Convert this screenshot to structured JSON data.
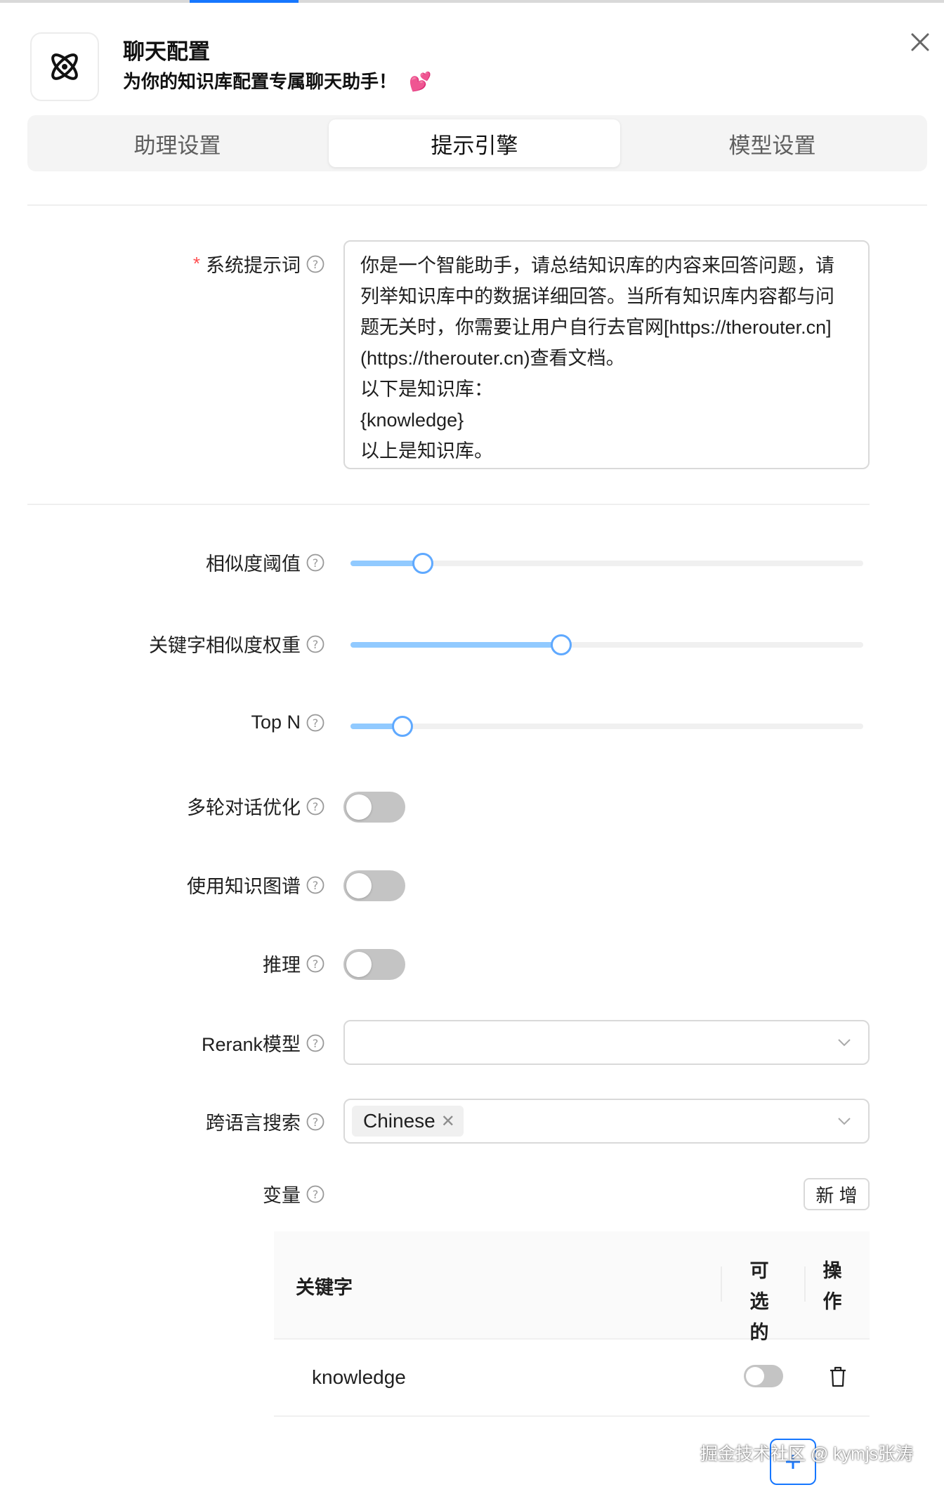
{
  "header": {
    "title": "聊天配置",
    "subtitle": "为你的知识库配置专属聊天助手！",
    "subtitle_emoji": "💕"
  },
  "tabs": [
    {
      "label": "助理设置",
      "active": false
    },
    {
      "label": "提示引擎",
      "active": true
    },
    {
      "label": "模型设置",
      "active": false
    }
  ],
  "form": {
    "system_prompt": {
      "label": "系统提示词",
      "required": true,
      "value": "你是一个智能助手，请总结知识库的内容来回答问题，请列举知识库中的数据详细回答。当所有知识库内容都与问题无关时，你需要让用户自行去官网[https://therouter.cn](https://therouter.cn)查看文档。\n以下是知识库：\n{knowledge}\n以上是知识库。"
    },
    "similarity_threshold": {
      "label": "相似度阈值",
      "value_fraction": 0.14
    },
    "keyword_weight": {
      "label": "关键字相似度权重",
      "value_fraction": 0.41
    },
    "top_n": {
      "label": "Top N",
      "value_fraction": 0.1
    },
    "multi_turn": {
      "label": "多轮对话优化",
      "on": false
    },
    "knowledge_graph": {
      "label": "使用知识图谱",
      "on": false
    },
    "reasoning": {
      "label": "推理",
      "on": false
    },
    "rerank": {
      "label": "Rerank模型",
      "value": ""
    },
    "cross_language": {
      "label": "跨语言搜索",
      "tags": [
        "Chinese"
      ]
    },
    "variables": {
      "label": "变量",
      "add_label": "新 增",
      "columns": {
        "keyword": "关键字",
        "optional": "可选的",
        "action": "操作"
      },
      "rows": [
        {
          "keyword": "knowledge",
          "optional": false
        }
      ]
    }
  },
  "watermark": "掘金技术社区 @ kymjs张涛",
  "colors": {
    "accent": "#1677ff",
    "slider_fill": "#91caff",
    "required": "#ff4d4f"
  }
}
